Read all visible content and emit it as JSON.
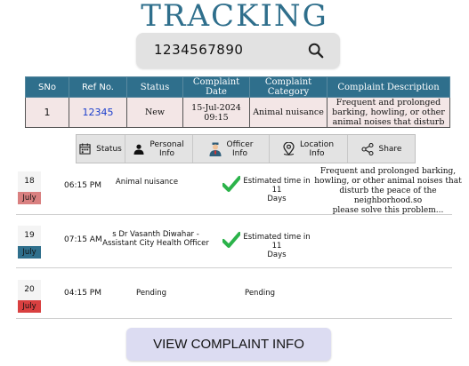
{
  "header": {
    "title": "TRACKING"
  },
  "search": {
    "value": "1234567890",
    "icon": "search-icon"
  },
  "table": {
    "headers": [
      "SNo",
      "Ref No.",
      "Status",
      "Complaint Date",
      "Complaint Category",
      "Complaint  Description"
    ],
    "row": {
      "sno": "1",
      "ref": "12345",
      "status": "New",
      "date_line1": "15-Jul-2024",
      "date_line2": "09:15",
      "category": "Animal nuisance",
      "desc_line1": "Frequent and prolonged",
      "desc_line2": "barking, howling, or other",
      "desc_line3": "animal noises that disturb"
    },
    "colors": {
      "header": "#2f6f8c",
      "row_bg": "#f3e6e6",
      "ref_link": "#1a3dcc"
    }
  },
  "tabs": [
    {
      "label": "Status",
      "icon": "calendar-icon"
    },
    {
      "label_line1": "Personal",
      "label_line2": "Info",
      "icon": "person-icon"
    },
    {
      "label_line1": "Officer",
      "label_line2": "Info",
      "icon": "officer-icon"
    },
    {
      "label_line1": "Location",
      "label_line2": "Info",
      "icon": "location-pin-icon"
    },
    {
      "label": "Share",
      "icon": "share-icon"
    }
  ],
  "timeline": [
    {
      "day": "18",
      "month": "July",
      "month_color": "#d98080",
      "time": "06:15 PM",
      "status": "Animal nuisance",
      "est_line1": "Estimated time in 11",
      "est_line2": "Days",
      "desc_line1": "Frequent and prolonged barking,",
      "desc_line2": "howling, or other animal noises that",
      "desc_line3": "disturb the peace of the neighborhood.so",
      "desc_line4": "please solve this problem..."
    },
    {
      "day": "19",
      "month": "July",
      "month_color": "#2f6f8c",
      "time": "07:15 AM",
      "status_line1": "s Dr Vasanth Diwahar -",
      "status_line2": "Assistant City Health Officer",
      "est_line1": "Estimated time in 11",
      "est_line2": "Days"
    },
    {
      "day": "20",
      "month": "July",
      "month_color": "#d94040",
      "time": "04:15 PM",
      "status": "Pending",
      "est": "Pending"
    }
  ],
  "footer": {
    "button_label": "VIEW COMPLAINT INFO"
  }
}
